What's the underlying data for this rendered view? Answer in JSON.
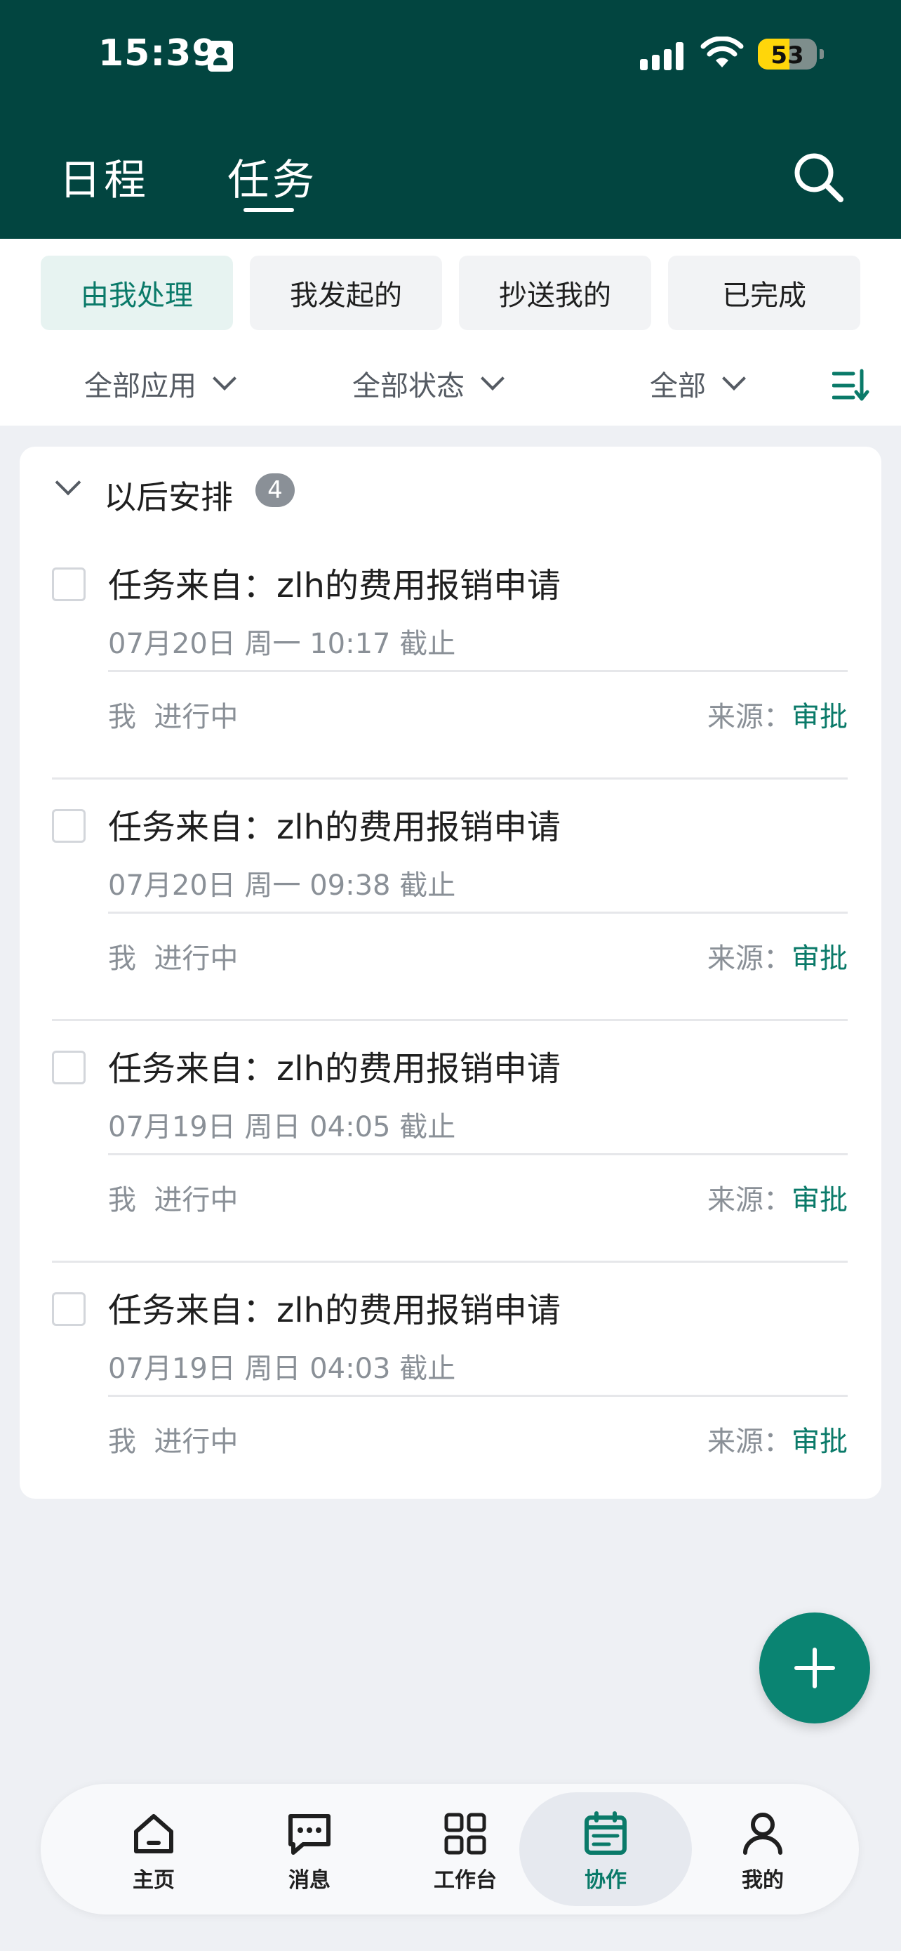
{
  "status_bar": {
    "time": "15:39",
    "battery": "53",
    "battery_level": 0.53
  },
  "header": {
    "tabs": [
      {
        "label": "日程",
        "active": false
      },
      {
        "label": "任务",
        "active": true
      }
    ],
    "search_icon": "search-icon"
  },
  "filters": {
    "chips": [
      {
        "label": "由我处理",
        "active": true
      },
      {
        "label": "我发起的",
        "active": false
      },
      {
        "label": "抄送我的",
        "active": false
      },
      {
        "label": "已完成",
        "active": false
      }
    ],
    "dropdowns": [
      {
        "label": "全部应用"
      },
      {
        "label": "全部状态"
      },
      {
        "label": "全部"
      }
    ],
    "sort_icon": "sort-icon"
  },
  "group": {
    "title": "以后安排",
    "count": "4"
  },
  "tasks": [
    {
      "title": "任务来自：zlh的费用报销申请",
      "deadline": "07月20日 周一 10:17 截止",
      "owner": "我",
      "status": "进行中",
      "source_label": "来源：",
      "source": "审批"
    },
    {
      "title": "任务来自：zlh的费用报销申请",
      "deadline": "07月20日 周一 09:38 截止",
      "owner": "我",
      "status": "进行中",
      "source_label": "来源：",
      "source": "审批"
    },
    {
      "title": "任务来自：zlh的费用报销申请",
      "deadline": "07月19日 周日 04:05 截止",
      "owner": "我",
      "status": "进行中",
      "source_label": "来源：",
      "source": "审批"
    },
    {
      "title": "任务来自：zlh的费用报销申请",
      "deadline": "07月19日 周日 04:03 截止",
      "owner": "我",
      "status": "进行中",
      "source_label": "来源：",
      "source": "审批"
    }
  ],
  "bottom_nav": [
    {
      "label": "主页",
      "icon": "home-icon",
      "active": false
    },
    {
      "label": "消息",
      "icon": "message-icon",
      "active": false
    },
    {
      "label": "工作台",
      "icon": "grid-icon",
      "active": false
    },
    {
      "label": "协作",
      "icon": "calendar-icon",
      "active": true
    },
    {
      "label": "我的",
      "icon": "user-icon",
      "active": false
    }
  ],
  "colors": {
    "header_bg": "#024540",
    "accent": "#0a7a69",
    "fab": "#0a8472",
    "page_bg": "#eef0f4"
  }
}
